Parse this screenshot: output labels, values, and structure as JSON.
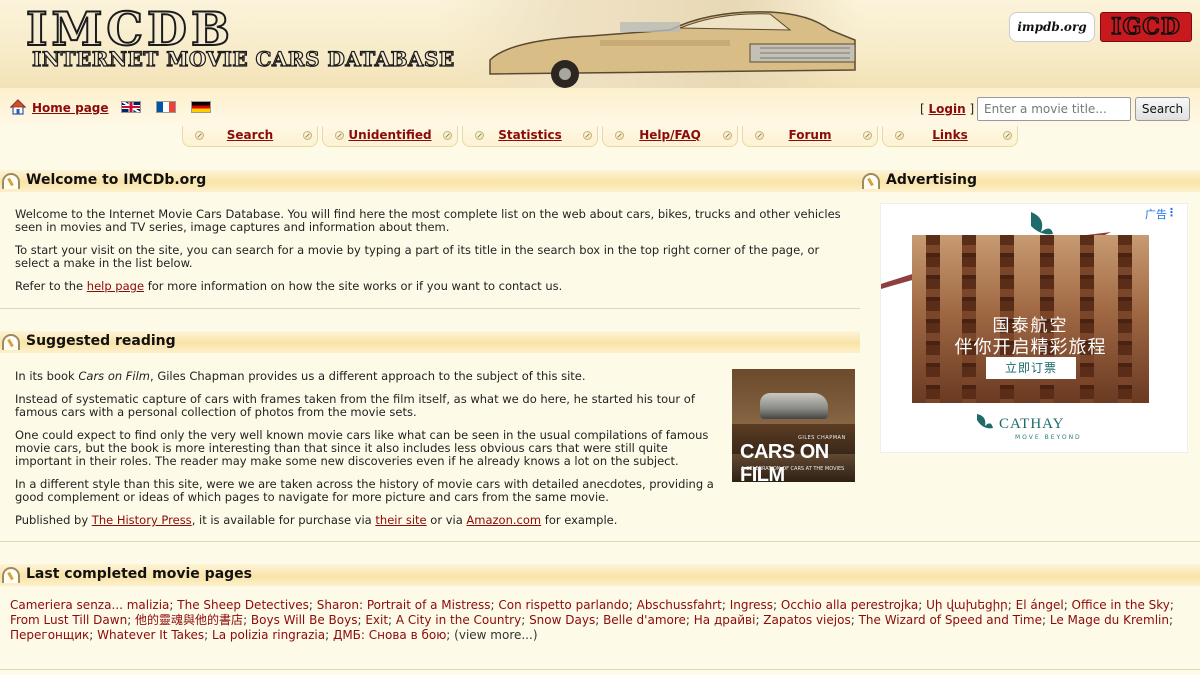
{
  "header": {
    "logo_title": "IMCDB",
    "logo_subtitle": "INTERNET MOVIE CARS DATABASE",
    "partners": [
      "impdb.org",
      "IGCD"
    ]
  },
  "topbar": {
    "home_label": "Home page",
    "languages": [
      "English",
      "Français",
      "Deutsch"
    ],
    "login_prefix": "[",
    "login_label": "Login",
    "login_suffix": "]",
    "search_placeholder": "Enter a movie title...",
    "search_button": "Search"
  },
  "nav": {
    "tabs": [
      "Search",
      "Unidentified",
      "Statistics",
      "Help/FAQ",
      "Forum",
      "Links"
    ]
  },
  "welcome": {
    "title": "Welcome to IMCDb.org",
    "p1": "Welcome to the Internet Movie Cars Database. You will find here the most complete list on the web about cars, bikes, trucks and other vehicles seen in movies and TV series, image captures and information about them.",
    "p2": "To start your visit on the site, you can search for a movie by typing a part of its title in the search box in the top right corner of the page, or select a make in the list below.",
    "p3_before": "Refer to the ",
    "p3_link": "help page",
    "p3_after": " for more information on how the site works or if you want to contact us."
  },
  "reading": {
    "title": "Suggested reading",
    "p1_before": "In its book ",
    "p1_book": "Cars on Film",
    "p1_after": ", Giles Chapman provides us a different approach to the subject of this site.",
    "p2": "Instead of systematic capture of cars with frames taken from the film itself, as what we do here, he started his tour of famous cars with a personal collection of photos from the movie sets.",
    "p3": "One could expect to find only the very well known movie cars like what can be seen in the usual compilations of famous movie cars, but the book is more interesting than that since it also includes less obvious cars that were still quite important in their roles. The reader may make some new discoveries even if he already knows a lot on the subject.",
    "p4": "In a different style than this site, were we are taken across the history of movie cars with detailed anecdotes, providing a good complement or ideas of which pages to navigate for more picture and cars from the same movie.",
    "p5_before": "Published by ",
    "p5_link1": "The History Press",
    "p5_mid": ", it is available for purchase via ",
    "p5_link2": "their site",
    "p5_mid2": " or via ",
    "p5_link3": "Amazon.com",
    "p5_after": " for example.",
    "book_cover": {
      "author": "GILES CHAPMAN",
      "title": "CARS ON FILM",
      "subtitle": "A CELEBRATION OF CARS AT THE MOVIES"
    }
  },
  "advertising": {
    "title": "Advertising",
    "ad_label": "广告",
    "ad_line1": "国泰航空",
    "ad_line2": "伴你开启精彩旅程",
    "ad_cta": "立即订票",
    "ad_brand": "CATHAY",
    "ad_tagline": "MOVE BEYOND"
  },
  "last_movies": {
    "title": "Last completed movie pages",
    "items": [
      "Cameriera senza... malizia",
      "The Sheep Detectives",
      "Sharon: Portrait of a Mistress",
      "Con rispetto parlando",
      "Abschussfahrt",
      "Ingress",
      "Occhio alla perestrojka",
      "Սի վախեցիր",
      "El ángel",
      "Office in the Sky",
      "From Lust Till Dawn",
      "他的靈魂與他的書店",
      "Boys Will Be Boys",
      "Exit",
      "A City in the Country",
      "Snow Days",
      "Belle d'amore",
      "На драйві",
      "Zapatos viejos",
      "The Wizard of Speed and Time",
      "Le Mage du Kremlin",
      "Перегонщик",
      "Whatever It Takes",
      "La polizia ringrazia",
      "ДМБ: Снова в бою"
    ],
    "view_more": "(view more...)"
  }
}
